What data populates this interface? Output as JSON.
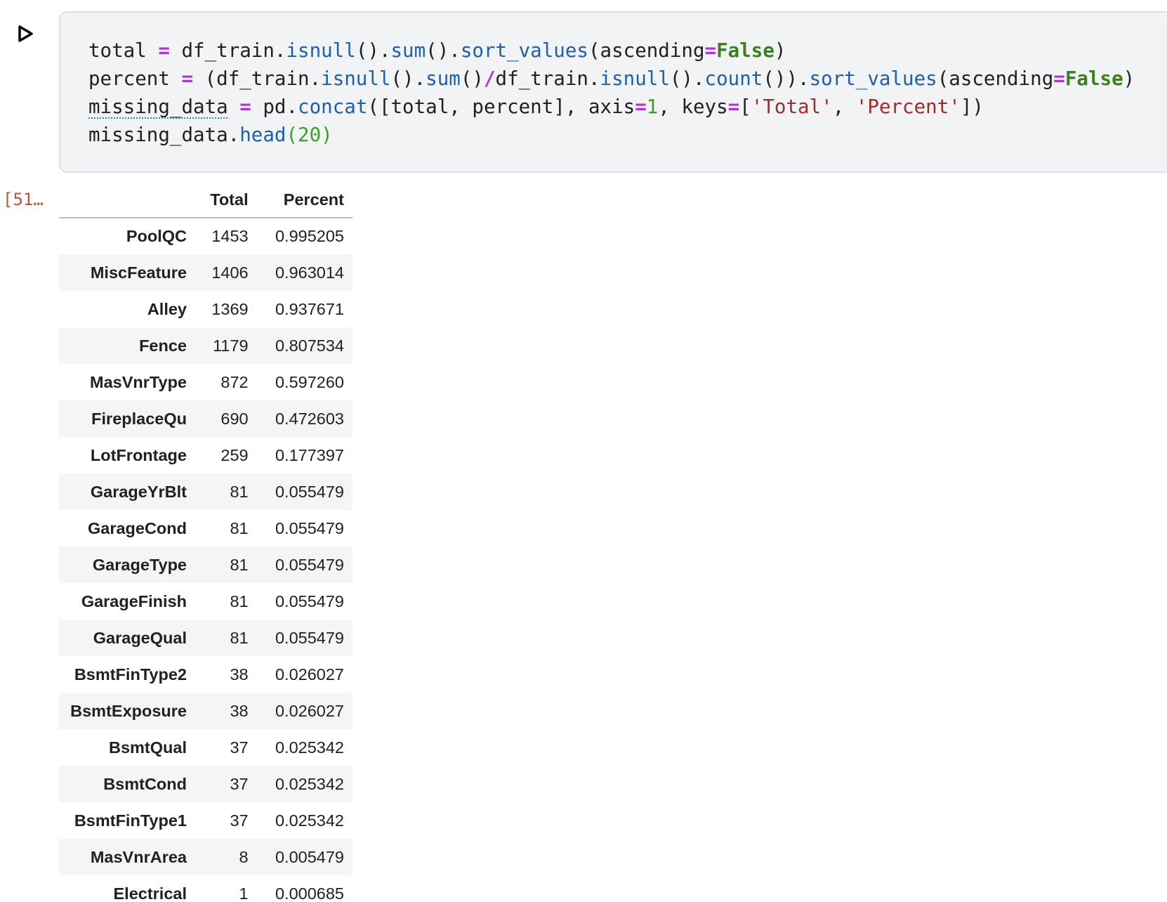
{
  "code_cell": {
    "lines": [
      [
        {
          "t": "total ",
          "c": ""
        },
        {
          "t": "=",
          "c": "t-op"
        },
        {
          "t": " df_train.",
          "c": ""
        },
        {
          "t": "isnull",
          "c": "t-fn"
        },
        {
          "t": "().",
          "c": ""
        },
        {
          "t": "sum",
          "c": "t-fn"
        },
        {
          "t": "().",
          "c": ""
        },
        {
          "t": "sort_values",
          "c": "t-fn"
        },
        {
          "t": "(ascending",
          "c": ""
        },
        {
          "t": "=",
          "c": "t-op"
        },
        {
          "t": "False",
          "c": "t-kw"
        },
        {
          "t": ")",
          "c": ""
        }
      ],
      [
        {
          "t": "percent ",
          "c": ""
        },
        {
          "t": "=",
          "c": "t-op"
        },
        {
          "t": " (df_train.",
          "c": ""
        },
        {
          "t": "isnull",
          "c": "t-fn"
        },
        {
          "t": "().",
          "c": ""
        },
        {
          "t": "sum",
          "c": "t-fn"
        },
        {
          "t": "()",
          "c": ""
        },
        {
          "t": "/",
          "c": "t-op"
        },
        {
          "t": "df_train.",
          "c": ""
        },
        {
          "t": "isnull",
          "c": "t-fn"
        },
        {
          "t": "().",
          "c": ""
        },
        {
          "t": "count",
          "c": "t-fn"
        },
        {
          "t": "()).",
          "c": ""
        },
        {
          "t": "sort_values",
          "c": "t-fn"
        },
        {
          "t": "(ascending",
          "c": ""
        },
        {
          "t": "=",
          "c": "t-op"
        },
        {
          "t": "False",
          "c": "t-kw"
        },
        {
          "t": ")",
          "c": ""
        }
      ],
      [
        {
          "t": "missing_data",
          "c": "t-under"
        },
        {
          "t": " ",
          "c": ""
        },
        {
          "t": "=",
          "c": "t-op"
        },
        {
          "t": " pd.",
          "c": ""
        },
        {
          "t": "concat",
          "c": "t-fn"
        },
        {
          "t": "([total, percent], axis",
          "c": ""
        },
        {
          "t": "=",
          "c": "t-op"
        },
        {
          "t": "1",
          "c": "t-num"
        },
        {
          "t": ", keys",
          "c": ""
        },
        {
          "t": "=",
          "c": "t-op"
        },
        {
          "t": "[",
          "c": ""
        },
        {
          "t": "'Total'",
          "c": "t-str"
        },
        {
          "t": ", ",
          "c": ""
        },
        {
          "t": "'Percent'",
          "c": "t-str"
        },
        {
          "t": "])",
          "c": ""
        }
      ],
      [
        {
          "t": "missing_data.",
          "c": ""
        },
        {
          "t": "head",
          "c": "t-fn"
        },
        {
          "t": "(20)",
          "c": "t-num"
        }
      ]
    ]
  },
  "execution_count": "[51…",
  "output_table": {
    "columns": [
      "",
      "Total",
      "Percent"
    ],
    "rows": [
      [
        "PoolQC",
        "1453",
        "0.995205"
      ],
      [
        "MiscFeature",
        "1406",
        "0.963014"
      ],
      [
        "Alley",
        "1369",
        "0.937671"
      ],
      [
        "Fence",
        "1179",
        "0.807534"
      ],
      [
        "MasVnrType",
        "872",
        "0.597260"
      ],
      [
        "FireplaceQu",
        "690",
        "0.472603"
      ],
      [
        "LotFrontage",
        "259",
        "0.177397"
      ],
      [
        "GarageYrBlt",
        "81",
        "0.055479"
      ],
      [
        "GarageCond",
        "81",
        "0.055479"
      ],
      [
        "GarageType",
        "81",
        "0.055479"
      ],
      [
        "GarageFinish",
        "81",
        "0.055479"
      ],
      [
        "GarageQual",
        "81",
        "0.055479"
      ],
      [
        "BsmtFinType2",
        "38",
        "0.026027"
      ],
      [
        "BsmtExposure",
        "38",
        "0.026027"
      ],
      [
        "BsmtQual",
        "37",
        "0.025342"
      ],
      [
        "BsmtCond",
        "37",
        "0.025342"
      ],
      [
        "BsmtFinType1",
        "37",
        "0.025342"
      ],
      [
        "MasVnrArea",
        "8",
        "0.005479"
      ],
      [
        "Electrical",
        "1",
        "0.000685"
      ]
    ]
  },
  "icons": {
    "run": "play-triangle-icon"
  }
}
